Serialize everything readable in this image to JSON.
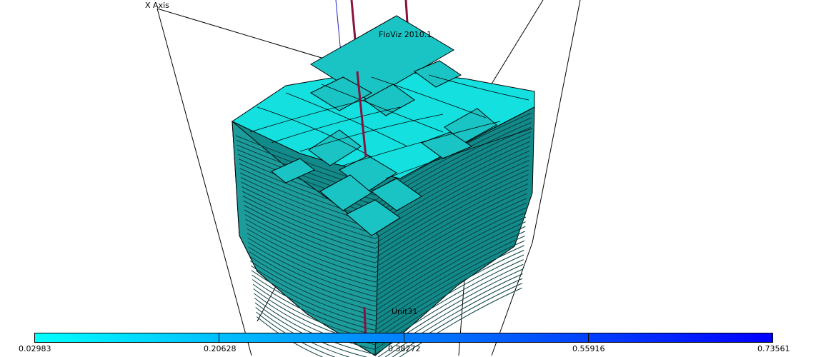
{
  "viewer": {
    "axis_label": "X Axis",
    "watermark": "FloViz 2010.1",
    "well_label": "Unit31"
  },
  "colorbar": {
    "stops": [
      "#00ffff",
      "#0000ff"
    ],
    "ticks": [
      "0.02983",
      "0.20628",
      "0.38272",
      "0.55916",
      "0.73561"
    ]
  },
  "colors": {
    "cell_top": "#14e0e0",
    "cell_top_shadow": "#1aa8a8",
    "cell_side": "#138a8a",
    "edge": "#000000",
    "well_a": "#8a1040",
    "well_b": "#2020c0"
  }
}
